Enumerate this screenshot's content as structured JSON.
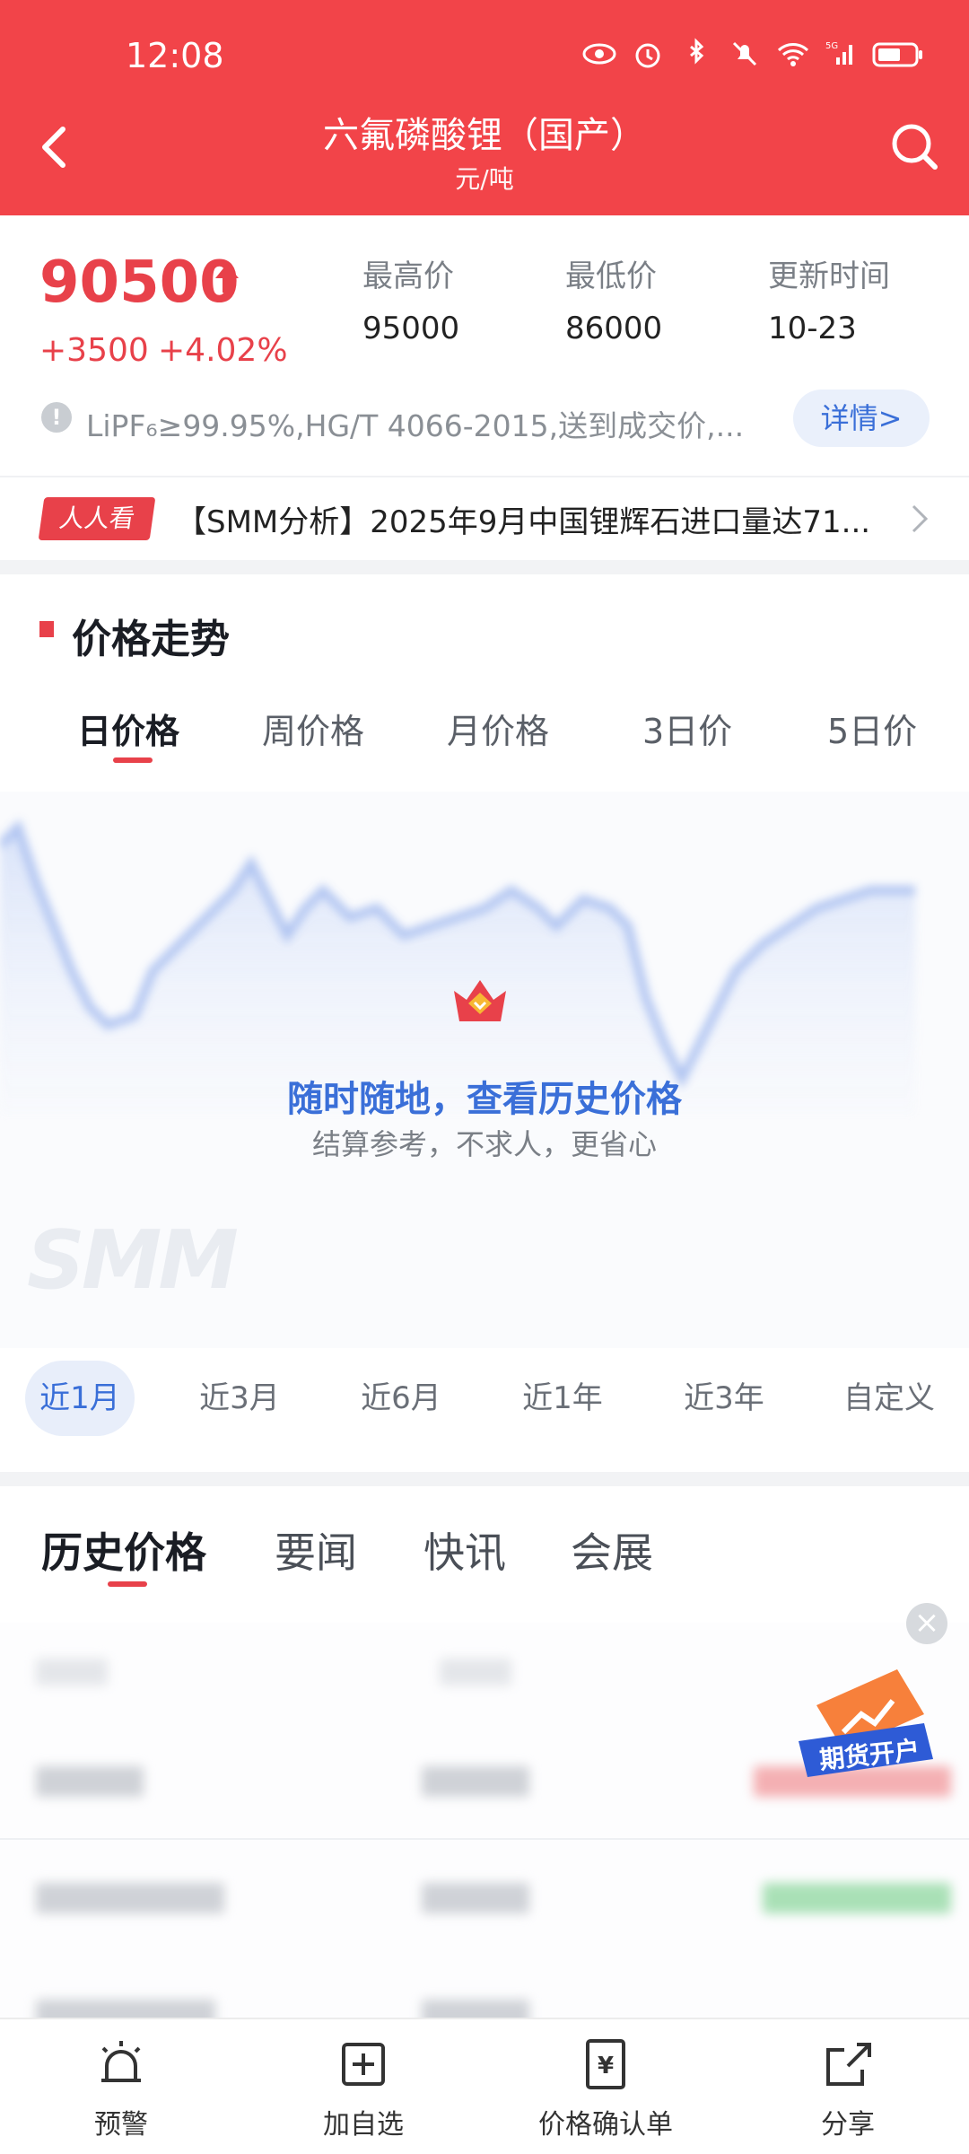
{
  "status_bar": {
    "time": "12:08",
    "icons": [
      "eye-icon",
      "alarm-icon",
      "bluetooth-icon",
      "mute-icon",
      "wifi-icon",
      "signal-5g-icon",
      "battery-icon"
    ]
  },
  "header": {
    "title": "六氟磷酸锂（国产）",
    "subtitle": "元/吨"
  },
  "quote": {
    "price": "90500",
    "change": "+3500",
    "change_pct": "+4.02%",
    "high_label": "最高价",
    "high": "95000",
    "low_label": "最低价",
    "low": "86000",
    "update_label": "更新时间",
    "update": "10-23",
    "spec": "LiPF₆≥99.95%,HG/T 4066-2015,送到成交价,...",
    "detail_btn": "详情>"
  },
  "news": {
    "tag": "人人看",
    "text": "【SMM分析】2025年9月中国锂辉石进口量达71..."
  },
  "trend": {
    "title": "价格走势",
    "tabs": [
      "日价格",
      "周价格",
      "月价格",
      "3日价",
      "5日价"
    ],
    "active_tab": 0,
    "cta_main": "随时随地，查看历史价格",
    "cta_sub": "结算参考，不求人，更省心",
    "watermark": "SMM"
  },
  "ranges": {
    "items": [
      "近1月",
      "近3月",
      "近6月",
      "近1年",
      "近3年",
      "自定义"
    ],
    "active": 0
  },
  "content_tabs": {
    "items": [
      "历史价格",
      "要闻",
      "快讯",
      "会展"
    ],
    "active": 0
  },
  "promo": {
    "label": "期货开户"
  },
  "bottom_nav": {
    "items": [
      {
        "label": "预警",
        "icon": "alarm-bell-icon"
      },
      {
        "label": "加自选",
        "icon": "add-favorite-icon"
      },
      {
        "label": "价格确认单",
        "icon": "price-confirm-icon"
      },
      {
        "label": "分享",
        "icon": "share-icon"
      }
    ]
  },
  "colors": {
    "header": "#F24449",
    "accent_red": "#E8414A",
    "accent_blue": "#3A6FD8"
  }
}
